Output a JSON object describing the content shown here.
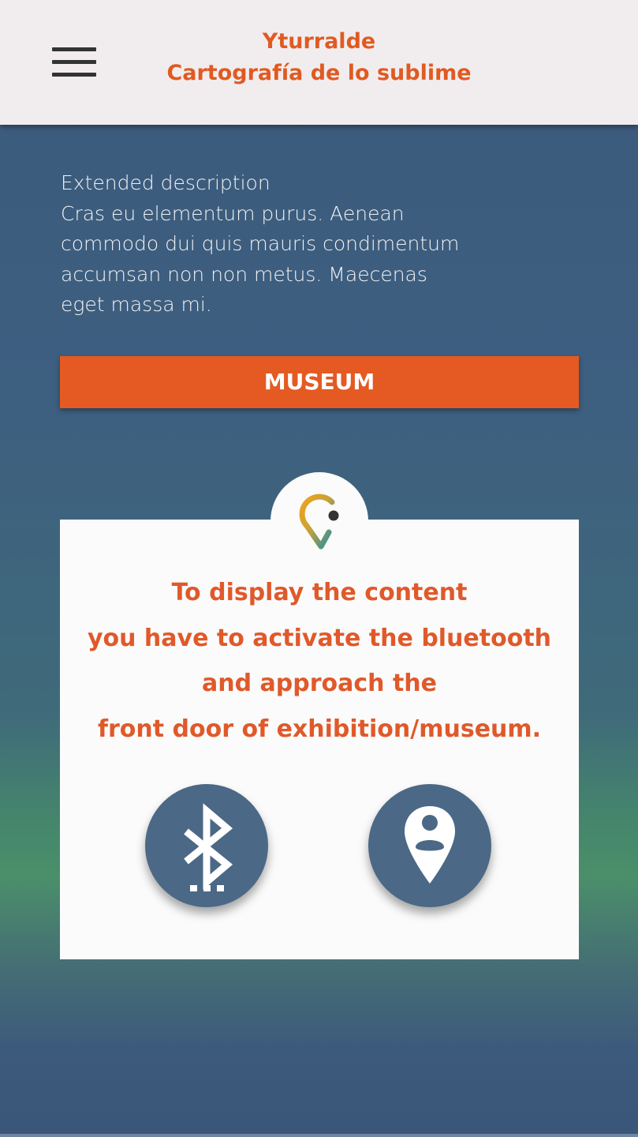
{
  "header": {
    "title_line1": "Yturralde",
    "title_line2": "Cartografía de lo sublime",
    "menu_icon": "hamburger-menu-icon"
  },
  "description": {
    "heading": "Extended description",
    "lines": [
      "Cras eu elementum purus. Aenean",
      "commodo dui quis mauris condimentum",
      "accumsan non non metus. Maecenas",
      "eget massa mi."
    ]
  },
  "museum_button": {
    "label": "MUSEUM"
  },
  "card": {
    "logo_icon": "location-pin-logo-icon",
    "message_lines": [
      "To display the content",
      "you have to activate the bluetooth",
      "and approach the",
      "front door of exhibition/museum."
    ],
    "bluetooth_icon": "bluetooth-searching-icon",
    "location_icon": "person-location-pin-icon"
  },
  "colors": {
    "accent": "#e55a22",
    "header_bg": "#f1edee",
    "button_circle": "#4b6886",
    "background_top": "#3c5a7c",
    "background_mid": "#4a8f6a"
  }
}
